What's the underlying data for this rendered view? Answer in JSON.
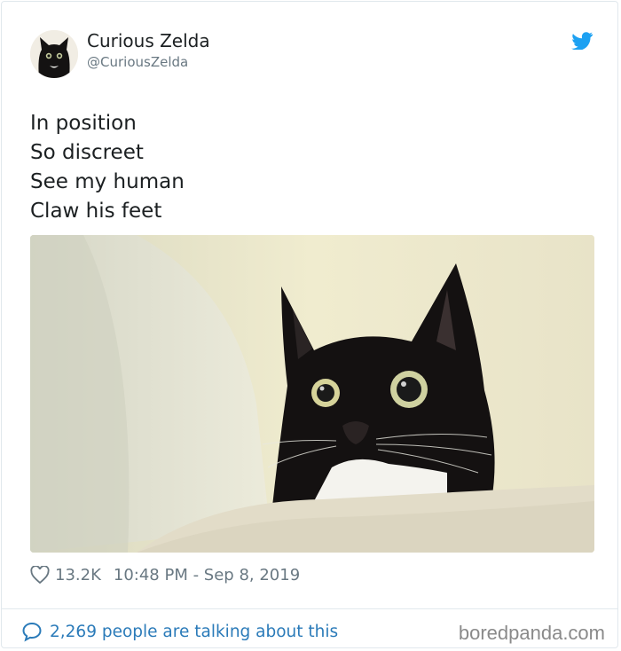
{
  "author": {
    "name": "Curious Zelda",
    "handle": "@CuriousZelda"
  },
  "tweet": {
    "lines": [
      "In position",
      "So discreet",
      "See my human",
      "Claw his feet"
    ]
  },
  "meta": {
    "likes": "13.2K",
    "timestamp": "10:48 PM - Sep 8, 2019"
  },
  "footer": {
    "talking": "2,269 people are talking about this"
  },
  "watermark": "boredpanda.com",
  "icons": {
    "brand": "twitter-icon",
    "like": "heart-icon",
    "comment": "speech-bubble-icon"
  },
  "colors": {
    "text": "#1c2022",
    "muted": "#697882",
    "link": "#2b7bb9",
    "twitter": "#1da1f2"
  }
}
